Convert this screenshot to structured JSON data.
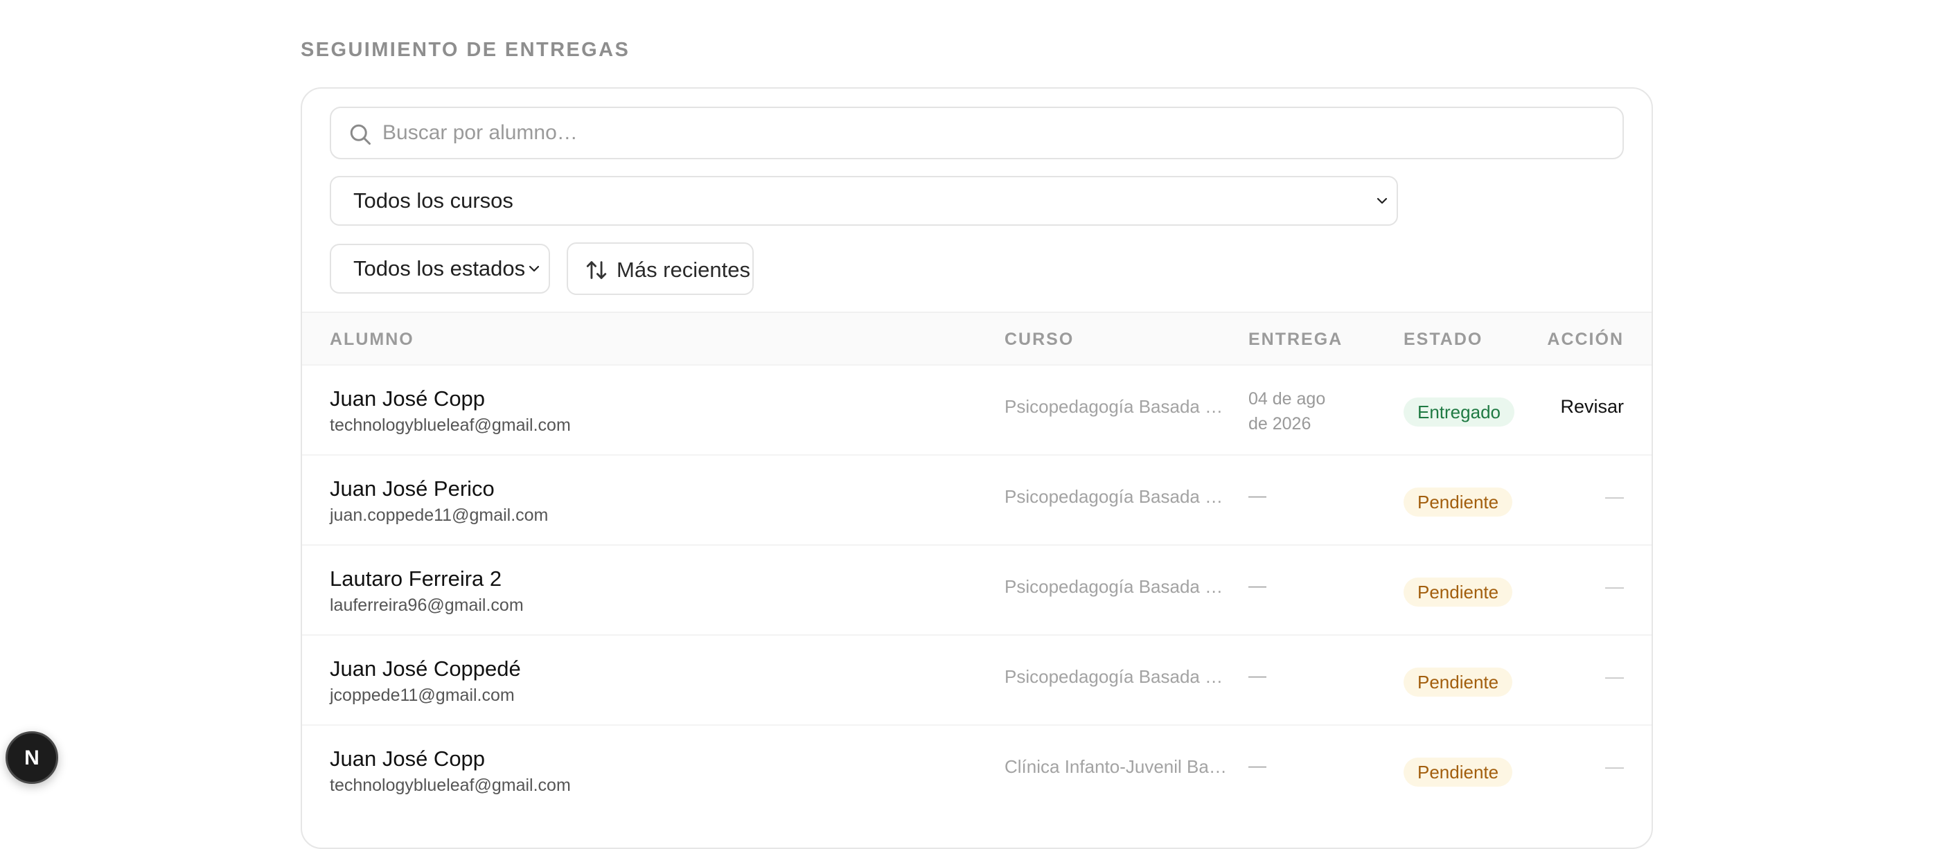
{
  "page": {
    "section_title": "SEGUIMIENTO DE ENTREGAS"
  },
  "search": {
    "placeholder": "Buscar por alumno…",
    "value": ""
  },
  "filters": {
    "course_selected": "Todos los cursos",
    "status_selected": "Todos los estados",
    "sort_label": "Más recientes"
  },
  "table": {
    "headers": {
      "student": "ALUMNO",
      "course": "CURSO",
      "delivery": "ENTREGA",
      "status": "ESTADO",
      "action": "ACCIÓN"
    },
    "rows": [
      {
        "name": "Juan José Copp",
        "email": "technologyblueleaf@gmail.com",
        "course": "Psicopedagogía Basada en…",
        "delivery": "04 de ago de 2026",
        "status": "Entregado",
        "status_type": "delivered",
        "action": "Revisar"
      },
      {
        "name": "Juan José Perico",
        "email": "juan.coppede11@gmail.com",
        "course": "Psicopedagogía Basada en…",
        "delivery": "—",
        "status": "Pendiente",
        "status_type": "pending",
        "action": "—"
      },
      {
        "name": "Lautaro Ferreira 2",
        "email": "lauferreira96@gmail.com",
        "course": "Psicopedagogía Basada en…",
        "delivery": "—",
        "status": "Pendiente",
        "status_type": "pending",
        "action": "—"
      },
      {
        "name": "Juan José Coppedé",
        "email": "jcoppede11@gmail.com",
        "course": "Psicopedagogía Basada en…",
        "delivery": "—",
        "status": "Pendiente",
        "status_type": "pending",
        "action": "—"
      },
      {
        "name": "Juan José Copp",
        "email": "technologyblueleaf@gmail.com",
        "course": "Clínica Infanto-Juvenil Bas…",
        "delivery": "—",
        "status": "Pendiente",
        "status_type": "pending",
        "action": "—"
      }
    ]
  },
  "dev_badge": {
    "letter": "N"
  },
  "colors": {
    "delivered_bg": "#eaf7ee",
    "delivered_fg": "#1f7a43",
    "pending_bg": "#fdf6e3",
    "pending_fg": "#a25e0d"
  }
}
